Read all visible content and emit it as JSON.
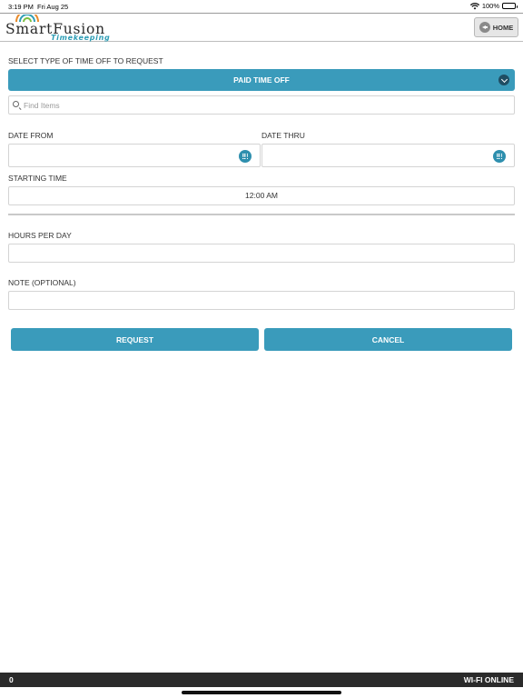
{
  "status_bar": {
    "time": "3:19 PM",
    "date": "Fri Aug 25",
    "battery": "100%",
    "battery_level": 1.0
  },
  "header": {
    "logo_brand": "SmartFusion",
    "logo_tagline": "Timekeeping",
    "home_label": "HOME"
  },
  "form": {
    "type_label": "SELECT TYPE OF TIME OFF TO REQUEST",
    "type_selected": "PAID TIME OFF",
    "search_placeholder": "Find Items",
    "date_from_label": "DATE FROM",
    "date_thru_label": "DATE THRU",
    "starting_time_label": "STARTING TIME",
    "starting_time_value": "12:00 AM",
    "hours_label": "HOURS PER DAY",
    "note_label": "NOTE (OPTIONAL)"
  },
  "actions": {
    "request_label": "REQUEST",
    "cancel_label": "CANCEL"
  },
  "footer": {
    "count": "0",
    "connection": "WI-FI ONLINE"
  },
  "colors": {
    "accent": "#3a9bbb",
    "accent_dark": "#1f4d63",
    "footer_bg": "#2b2b2b"
  }
}
